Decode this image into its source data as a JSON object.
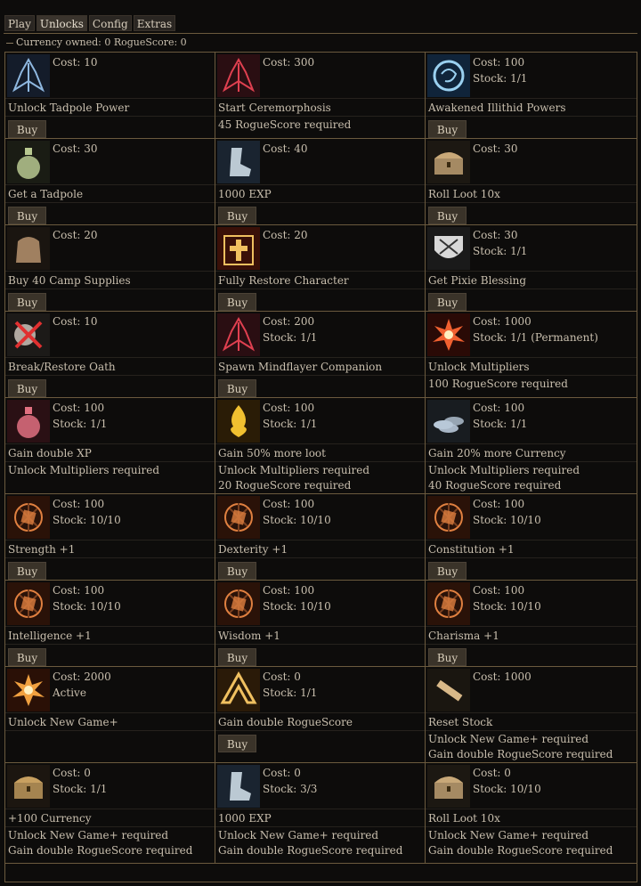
{
  "tabs": [
    "Play",
    "Unlocks",
    "Config",
    "Extras"
  ],
  "active_tab": "Unlocks",
  "currency_text": "Currency owned: 0  RogueScore: 0",
  "buy_label": "Buy",
  "rows": [
    {
      "cells": [
        {
          "icon": "tadpole-power-icon",
          "color": "#8fb8e0",
          "bg": "#141c2a",
          "stat1": "Cost: 10",
          "stat2": "",
          "name": "Unlock Tadpole Power",
          "req1": "",
          "req2": "",
          "buy": true
        },
        {
          "icon": "ceremorphosis-icon",
          "color": "#e04050",
          "bg": "#2a0e12",
          "stat1": "Cost: 300",
          "stat2": "",
          "name": "Start Ceremorphosis",
          "req1": "45 RogueScore required",
          "req2": "",
          "buy": false
        },
        {
          "icon": "illithid-brain-icon",
          "color": "#9ad0f0",
          "bg": "#10243a",
          "stat1": "Cost: 100",
          "stat2": "Stock: 1/1",
          "name": "Awakened Illithid Powers",
          "req1": "",
          "req2": "",
          "buy": true
        }
      ]
    },
    {
      "cells": [
        {
          "icon": "tadpole-jar-icon",
          "color": "#b8c890",
          "bg": "#1a1c14",
          "stat1": "Cost: 30",
          "stat2": "",
          "name": "Get a Tadpole",
          "req1": "",
          "req2": "",
          "buy": true
        },
        {
          "icon": "boot-icon",
          "color": "#d8e6f0",
          "bg": "#1a2430",
          "stat1": "Cost: 40",
          "stat2": "",
          "name": "1000 EXP",
          "req1": "",
          "req2": "",
          "buy": true
        },
        {
          "icon": "loot-chest-icon",
          "color": "#c8a878",
          "bg": "#1c1812",
          "stat1": "Cost: 30",
          "stat2": "",
          "name": "Roll Loot 10x",
          "req1": "",
          "req2": "",
          "buy": true
        }
      ]
    },
    {
      "cells": [
        {
          "icon": "supply-pack-icon",
          "color": "#a08060",
          "bg": "#1a1510",
          "stat1": "Cost: 20",
          "stat2": "",
          "name": "Buy 40 Camp Supplies",
          "req1": "",
          "req2": "",
          "buy": true
        },
        {
          "icon": "restore-cross-icon",
          "color": "#f0c060",
          "bg": "#3a1008",
          "stat1": "Cost: 20",
          "stat2": "",
          "name": "Fully Restore Character",
          "req1": "",
          "req2": "",
          "buy": true
        },
        {
          "icon": "pixie-shield-icon",
          "color": "#d8d8d8",
          "bg": "#1a1a1a",
          "stat1": "Cost: 30",
          "stat2": "Stock: 1/1",
          "name": "Get Pixie Blessing",
          "req1": "",
          "req2": "",
          "buy": true
        }
      ]
    },
    {
      "cells": [
        {
          "icon": "broken-oath-icon",
          "color": "#e03030",
          "bg": "#1c1a18",
          "stat1": "Cost: 10",
          "stat2": "",
          "name": "Break/Restore Oath",
          "req1": "",
          "req2": "",
          "buy": true
        },
        {
          "icon": "mindflayer-icon",
          "color": "#e04050",
          "bg": "#2a0e12",
          "stat1": "Cost: 200",
          "stat2": "Stock: 1/1",
          "name": "Spawn Mindflayer Companion",
          "req1": "",
          "req2": "",
          "buy": true
        },
        {
          "icon": "burst-icon",
          "color": "#f06030",
          "bg": "#2a0a06",
          "stat1": "Cost: 1000",
          "stat2": "Stock: 1/1 (Permanent)",
          "name": "Unlock Multipliers",
          "req1": "100 RogueScore required",
          "req2": "",
          "buy": false
        }
      ]
    },
    {
      "cells": [
        {
          "icon": "potion-icon",
          "color": "#e07080",
          "bg": "#2a1014",
          "stat1": "Cost: 100",
          "stat2": "Stock: 1/1",
          "name": "Gain double XP",
          "req1": "Unlock Multipliers required",
          "req2": "",
          "buy": false
        },
        {
          "icon": "golden-flame-icon",
          "color": "#f0c030",
          "bg": "#2a1c06",
          "stat1": "Cost: 100",
          "stat2": "Stock: 1/1",
          "name": "Gain 50% more loot",
          "req1": "Unlock Multipliers required",
          "req2": "20 RogueScore required",
          "buy": false
        },
        {
          "icon": "coins-icon",
          "color": "#b8c8d8",
          "bg": "#181c20",
          "stat1": "Cost: 100",
          "stat2": "Stock: 1/1",
          "name": "Gain 20% more Currency",
          "req1": "Unlock Multipliers required",
          "req2": "40 RogueScore required",
          "buy": false
        }
      ]
    },
    {
      "cells": [
        {
          "icon": "strength-rune-icon",
          "color": "#e08040",
          "bg": "#2a1208",
          "stat1": "Cost: 100",
          "stat2": "Stock: 10/10",
          "name": "Strength +1",
          "req1": "",
          "req2": "",
          "buy": true
        },
        {
          "icon": "dexterity-rune-icon",
          "color": "#e08040",
          "bg": "#2a1208",
          "stat1": "Cost: 100",
          "stat2": "Stock: 10/10",
          "name": "Dexterity +1",
          "req1": "",
          "req2": "",
          "buy": true
        },
        {
          "icon": "constitution-rune-icon",
          "color": "#e08040",
          "bg": "#2a1208",
          "stat1": "Cost: 100",
          "stat2": "Stock: 10/10",
          "name": "Constitution +1",
          "req1": "",
          "req2": "",
          "buy": true
        }
      ]
    },
    {
      "cells": [
        {
          "icon": "intelligence-rune-icon",
          "color": "#e08040",
          "bg": "#2a1208",
          "stat1": "Cost: 100",
          "stat2": "Stock: 10/10",
          "name": "Intelligence +1",
          "req1": "",
          "req2": "",
          "buy": true
        },
        {
          "icon": "wisdom-rune-icon",
          "color": "#e08040",
          "bg": "#2a1208",
          "stat1": "Cost: 100",
          "stat2": "Stock: 10/10",
          "name": "Wisdom +1",
          "req1": "",
          "req2": "",
          "buy": true
        },
        {
          "icon": "charisma-rune-icon",
          "color": "#e08040",
          "bg": "#2a1208",
          "stat1": "Cost: 100",
          "stat2": "Stock: 10/10",
          "name": "Charisma +1",
          "req1": "",
          "req2": "",
          "buy": true
        }
      ]
    },
    {
      "cells": [
        {
          "icon": "radiant-burst-icon",
          "color": "#f0a040",
          "bg": "#2a1006",
          "stat1": "Cost: 2000",
          "stat2": "Active",
          "name": "Unlock New Game+",
          "req1": "",
          "req2": "",
          "buy": false
        },
        {
          "icon": "up-arrow-icon",
          "color": "#f0c060",
          "bg": "#2a1a08",
          "stat1": "Cost: 0",
          "stat2": "Stock: 1/1",
          "name": "Gain double RogueScore",
          "req1": "",
          "req2": "",
          "buy": true
        },
        {
          "icon": "scroll-icon",
          "color": "#d8b888",
          "bg": "#1a1610",
          "stat1": "Cost: 1000",
          "stat2": "",
          "name": "Reset Stock",
          "req1": "Unlock New Game+ required",
          "req2": "Gain double RogueScore required",
          "buy": false
        }
      ]
    },
    {
      "cells": [
        {
          "icon": "treasure-chest-icon",
          "color": "#c8a060",
          "bg": "#1c1610",
          "stat1": "Cost: 0",
          "stat2": "Stock: 1/1",
          "name": "+100 Currency",
          "req1": "Unlock New Game+ required",
          "req2": "Gain double RogueScore required",
          "buy": false
        },
        {
          "icon": "boot-icon",
          "color": "#d8e6f0",
          "bg": "#1a2430",
          "stat1": "Cost: 0",
          "stat2": "Stock: 3/3",
          "name": "1000 EXP",
          "req1": "Unlock New Game+ required",
          "req2": "Gain double RogueScore required",
          "buy": false
        },
        {
          "icon": "loot-chest-icon",
          "color": "#c8a878",
          "bg": "#1c1812",
          "stat1": "Cost: 0",
          "stat2": "Stock: 10/10",
          "name": "Roll Loot 10x",
          "req1": "Unlock New Game+ required",
          "req2": "Gain double RogueScore required",
          "buy": false
        }
      ]
    }
  ]
}
